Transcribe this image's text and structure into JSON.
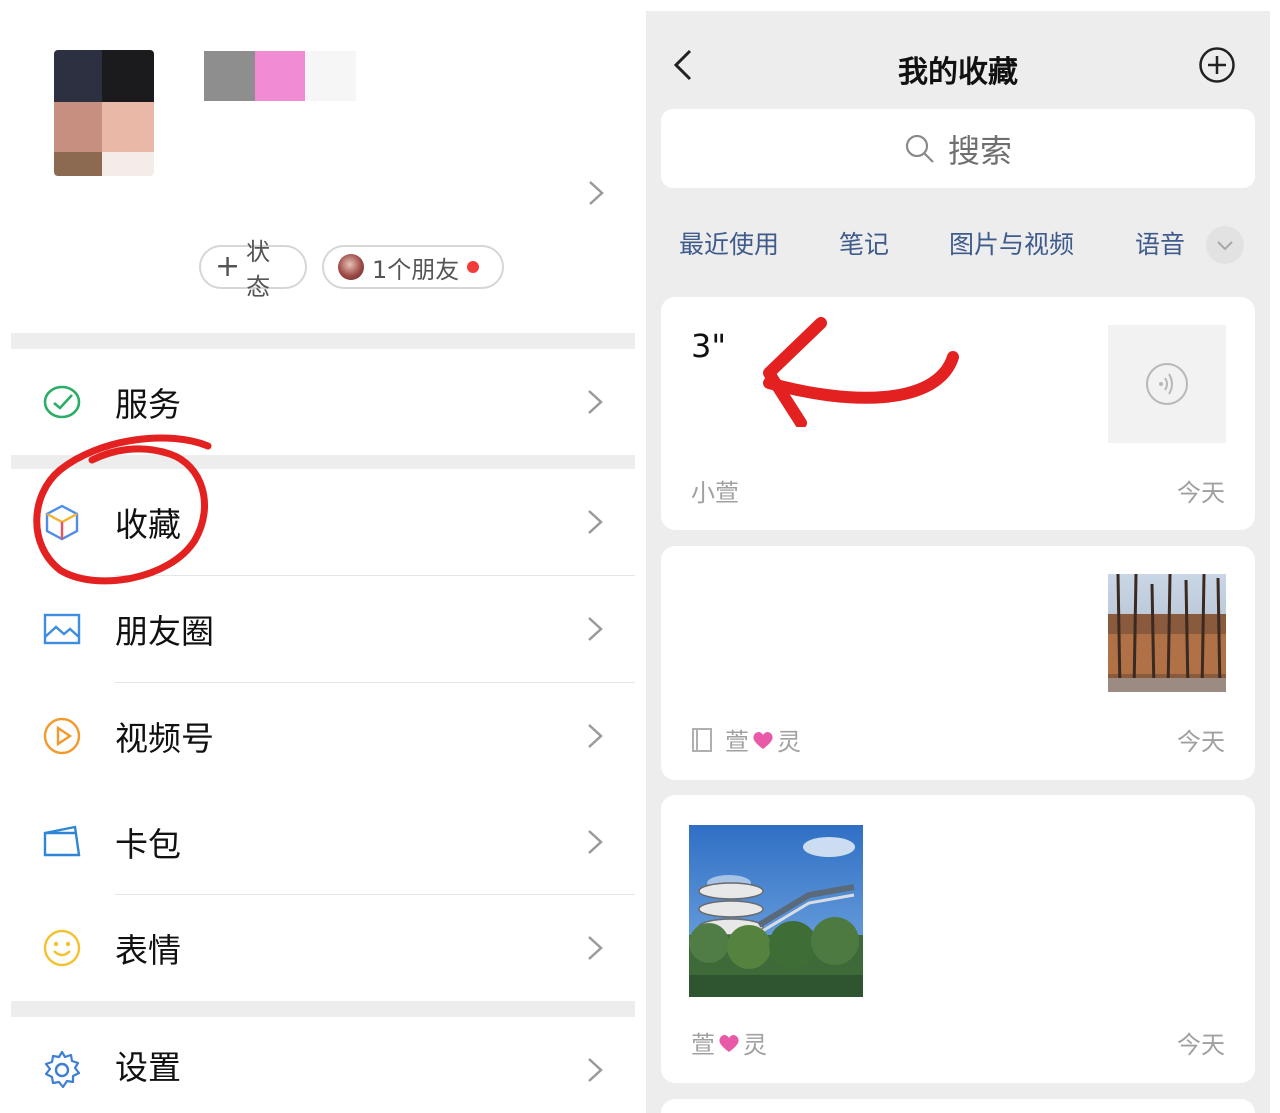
{
  "profile": {
    "status_chip": "状态",
    "friends_chip": "1个朋友"
  },
  "menu": {
    "items": [
      {
        "label": "服务"
      },
      {
        "label": "收藏"
      },
      {
        "label": "朋友圈"
      },
      {
        "label": "视频号"
      },
      {
        "label": "卡包"
      },
      {
        "label": "表情"
      },
      {
        "label": "设置"
      }
    ]
  },
  "favorites": {
    "title": "我的收藏",
    "search_placeholder": "搜索",
    "tabs": [
      "最近使用",
      "笔记",
      "图片与视频",
      "语音"
    ],
    "cards": [
      {
        "type": "voice",
        "duration": "3\"",
        "source": "小萱",
        "date": "今天"
      },
      {
        "type": "note-image",
        "source_prefix": "萱",
        "source_suffix": "灵",
        "date": "今天"
      },
      {
        "type": "image",
        "source_prefix": "萱",
        "source_suffix": "灵",
        "date": "今天"
      }
    ]
  },
  "colors": {
    "accent_link": "#3f5b8c",
    "annotation_red": "#e32121",
    "status_dot": "#f23c3c",
    "page_background": "#ededed"
  }
}
